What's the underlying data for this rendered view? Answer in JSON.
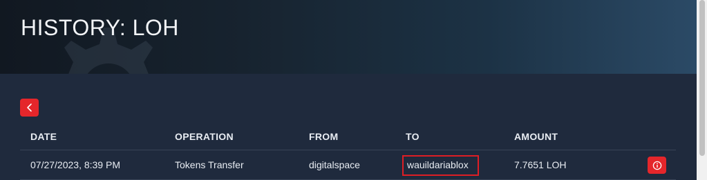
{
  "page": {
    "title": "HISTORY: LOH"
  },
  "toolbar": {
    "back_icon": "chevron-left-icon"
  },
  "table": {
    "columns": [
      "DATE",
      "OPERATION",
      "FROM",
      "TO",
      "AMOUNT"
    ],
    "rows": [
      {
        "date": "07/27/2023, 8:39 PM",
        "operation": "Tokens Transfer",
        "from": "digitalspace",
        "to": "wauildariablox",
        "amount": "7.7651 LOH",
        "action_icon": "info-icon"
      }
    ]
  },
  "colors": {
    "accent": "#e5262b",
    "background": "#1f2a3d",
    "highlight_border": "#e01e24"
  }
}
